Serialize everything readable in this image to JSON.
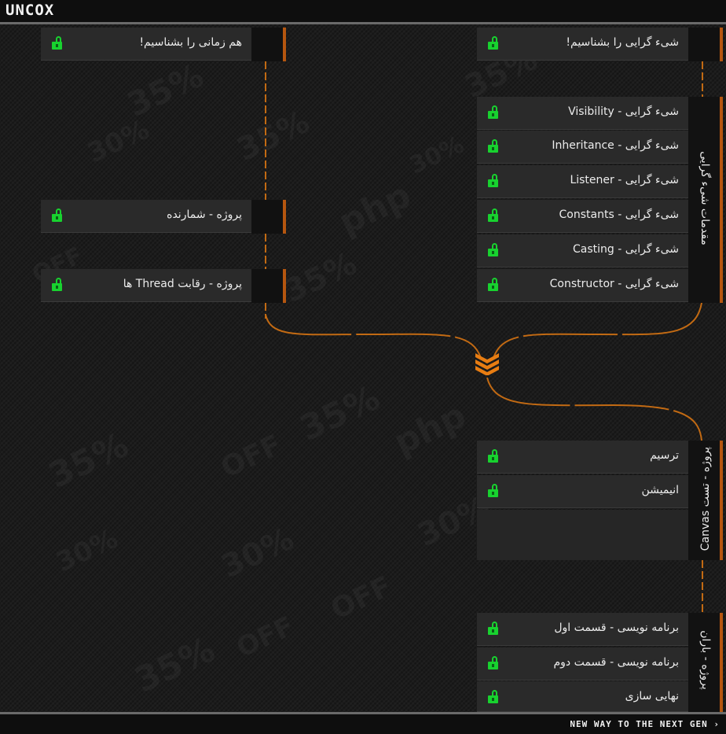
{
  "header": {
    "logo": "UNCOX"
  },
  "footer": {
    "tagline": "NEW WAY TO THE NEXT GEN ›"
  },
  "colors": {
    "accent": "#c26a13",
    "unlocked": "#18d22f",
    "panel": "#2a2a2a"
  },
  "left_lessons": [
    {
      "title": "هم زمانی را بشناسیم!",
      "icon": "unlocked-lock-icon"
    },
    {
      "title": "پروژه - شمارنده",
      "icon": "unlocked-lock-icon"
    },
    {
      "title": "پروژه - رقابت Thread ها",
      "icon": "unlocked-lock-icon"
    }
  ],
  "right_top_lesson": {
    "title": "شیء گرایی را بشناسیم!",
    "icon": "unlocked-lock-icon"
  },
  "groups": [
    {
      "label": "مقدمات شیء گرایی",
      "lessons": [
        "شیء گرایی - Visibility",
        "شیء گرایی - Inheritance",
        "شیء گرایی - Listener",
        "شیء گرایی - Constants",
        "شیء گرایی - Casting",
        "شیء گرایی - Constructor"
      ]
    },
    {
      "label": "پروژه - تست Canvas",
      "lessons": [
        "ترسیم",
        "انیمیشن"
      ]
    },
    {
      "label": "پروژه - باران",
      "lessons": [
        "برنامه نویسی - قسمت اول",
        "برنامه نویسی - قسمت دوم",
        "نهایی سازی"
      ]
    }
  ]
}
